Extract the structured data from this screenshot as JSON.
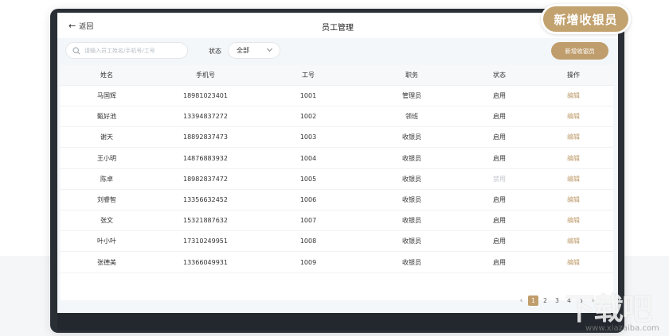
{
  "badge": {
    "label": "新增收银员"
  },
  "topbar": {
    "back_label": "返回",
    "title": "员工管理"
  },
  "filters": {
    "search_placeholder": "请输入员工姓名/手机号/工号",
    "status_label": "状态",
    "status_value": "全部",
    "add_button_label": "新增收银员"
  },
  "table": {
    "headers": [
      "姓名",
      "手机号",
      "工号",
      "职务",
      "状态",
      "操作"
    ],
    "rows": [
      {
        "name": "马国辉",
        "phone": "18981023401",
        "id": "1001",
        "role": "管理员",
        "status": "启用",
        "action": "编辑",
        "enabled": true
      },
      {
        "name": "甄好池",
        "phone": "13394837272",
        "id": "1002",
        "role": "领班",
        "status": "启用",
        "action": "编辑",
        "enabled": true
      },
      {
        "name": "谢天",
        "phone": "18892837473",
        "id": "1003",
        "role": "收银员",
        "status": "启用",
        "action": "编辑",
        "enabled": true
      },
      {
        "name": "王小明",
        "phone": "14876883932",
        "id": "1004",
        "role": "收银员",
        "status": "启用",
        "action": "编辑",
        "enabled": true
      },
      {
        "name": "陈卓",
        "phone": "18982837472",
        "id": "1005",
        "role": "收银员",
        "status": "禁用",
        "action": "编辑",
        "enabled": false
      },
      {
        "name": "刘睿智",
        "phone": "13356632452",
        "id": "1006",
        "role": "收银员",
        "status": "启用",
        "action": "编辑",
        "enabled": true
      },
      {
        "name": "张文",
        "phone": "15321887632",
        "id": "1007",
        "role": "收银员",
        "status": "启用",
        "action": "编辑",
        "enabled": true
      },
      {
        "name": "叶小叶",
        "phone": "17310249951",
        "id": "1008",
        "role": "收银员",
        "status": "启用",
        "action": "编辑",
        "enabled": true
      },
      {
        "name": "张德美",
        "phone": "13366049931",
        "id": "1009",
        "role": "收银员",
        "status": "启用",
        "action": "编辑",
        "enabled": true
      }
    ]
  },
  "pagination": {
    "pages": [
      "1",
      "2",
      "3",
      "4",
      "5"
    ],
    "current": "1",
    "prev_icon": "chevron-left-icon",
    "next_icon": "chevron-right-icon"
  },
  "watermark": {
    "text_cn": "下载吧",
    "text_en": "www.xiazaiba.com"
  },
  "colors": {
    "accent": "#bf9d6c",
    "disabled": "#c2c6cc"
  }
}
